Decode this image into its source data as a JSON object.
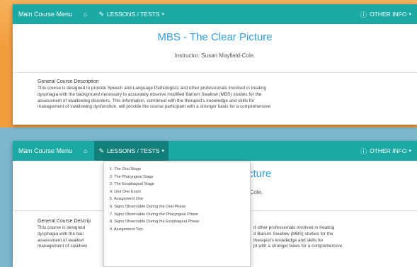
{
  "nav": {
    "brand": "Main Course Menu",
    "home_icon": "home-icon",
    "lessons_label": "LESSONS / TESTS",
    "other_label": "OTHER INFO",
    "caret": "▾"
  },
  "course": {
    "title": "MBS - The Clear Picture",
    "instructor": "Instructor: Susan Mayfield-Cole.",
    "title_partial": "cture",
    "instructor_partial": "-Cole.",
    "desc_heading": "General Course Description",
    "desc_heading_partial": "General Course Descrip",
    "desc_lines": [
      "This course is designed to provide Speech and Language Pathologists and other professionals involved in treating",
      "dysphagia with the background necessary to accurately observe modified Barium Swallow (MBS) studies for the",
      "assessment of swallowing disorders. This information, combined with the therapist's knowledge and skills for",
      "management of swallowing dysfunction, will provide the course participant with a stronger basis for a comprehensive"
    ],
    "desc_left_partial": [
      "This course is designed",
      "dysphagia with the bac",
      "assessment of swallovi",
      "management of swallowi"
    ],
    "desc_right_partial": [
      "d other professionals involved in treating",
      "d Barium Swallow (MBS) studies for the",
      "therapist's knowledge and skills for",
      "pt with a stronger basis for a comprehensive"
    ]
  },
  "dropdown": {
    "items": [
      "1. The Oral Stage",
      "2. The Pharyngeal Stage",
      "3. The Esophageal Stage",
      "4. Unit One Exam",
      "5. Assignment One",
      "6. Signs Observable During the Oral Phase",
      "7. Signs Observable During the Pharyngeal Phase",
      "8. Signs Observable During the Esophageal Phase",
      "9. Assignment Two"
    ]
  },
  "colors": {
    "navbar": "#1aa9a4",
    "title": "#2f9fd6",
    "background_top": "#f39c3c",
    "background_bottom": "#7cb7cf"
  }
}
